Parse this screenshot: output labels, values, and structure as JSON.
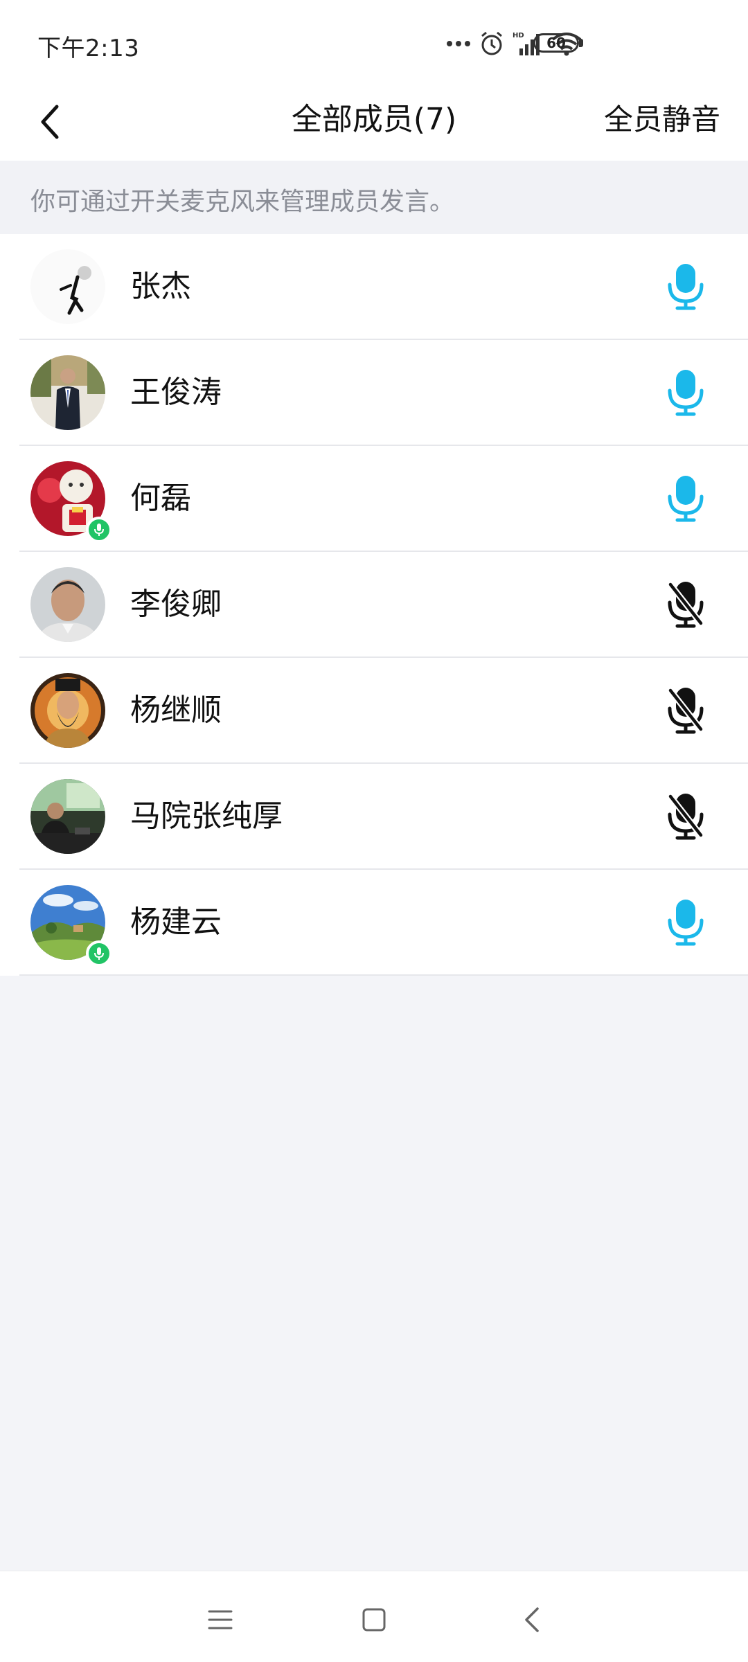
{
  "status_bar": {
    "time": "下午2:13",
    "battery": "60",
    "icons": [
      "more-dots-icon",
      "alarm-icon",
      "hd-signal-icon",
      "wifi-icon",
      "battery-icon"
    ]
  },
  "header": {
    "title": "全部成员(7)",
    "mute_all": "全员静音",
    "back_icon": "chevron-left-icon"
  },
  "hint": "你可通过开关麦克风来管理成员发言。",
  "members": [
    {
      "name": "张杰",
      "mic": "on",
      "speaking": false
    },
    {
      "name": "王俊涛",
      "mic": "on",
      "speaking": false
    },
    {
      "name": "何磊",
      "mic": "on",
      "speaking": true
    },
    {
      "name": "李俊卿",
      "mic": "off",
      "speaking": false
    },
    {
      "name": "杨继顺",
      "mic": "off",
      "speaking": false
    },
    {
      "name": "马院张纯厚",
      "mic": "off",
      "speaking": false
    },
    {
      "name": "杨建云",
      "mic": "on",
      "speaking": true
    }
  ],
  "colors": {
    "mic_on": "#1bb8ea",
    "mic_off": "#111111",
    "speaking_badge": "#21c466",
    "background": "#f3f4f8"
  },
  "system_nav": [
    "menu-icon",
    "home-icon",
    "back-icon"
  ]
}
